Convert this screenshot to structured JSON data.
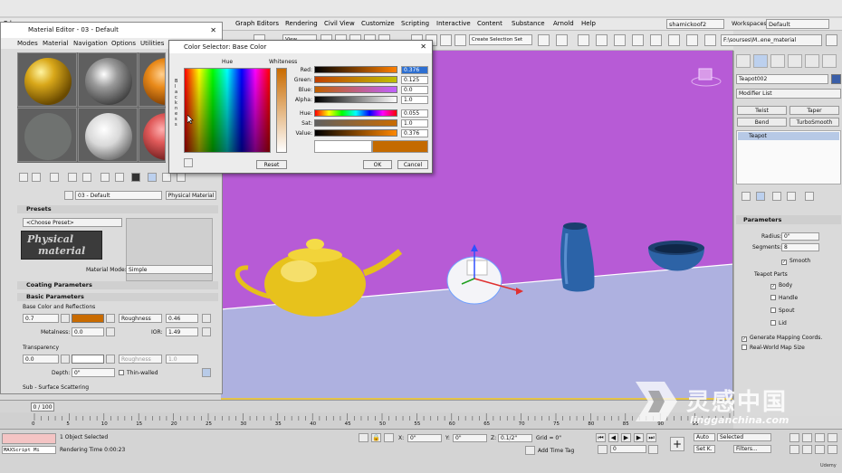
{
  "menubar": {
    "app_label": "Ed",
    "items": [
      "Graph Editors",
      "Rendering",
      "Civil View",
      "Customize",
      "Scripting",
      "Interactive",
      "Content",
      "Substance",
      "Arnold",
      "Help"
    ],
    "user": "shamickoof2",
    "workspaces_label": "Workspaces:",
    "workspace": "Default"
  },
  "toolbar": {
    "view_dropdown": "View",
    "selection_set": "Create Selection Set",
    "path": "F:\\sourses\\M..ene_material"
  },
  "material_editor": {
    "title": "Material Editor - 03 - Default",
    "menu": [
      "Modes",
      "Material",
      "Navigation",
      "Options",
      "Utilities"
    ],
    "material_name": "03 - Default",
    "material_type": "Physical Material",
    "presets_header": "Presets",
    "choose_preset": "<Choose Preset>",
    "logo_line1": "Physical",
    "logo_line2": "material",
    "material_mode_label": "Material Mode:",
    "material_mode": "Simple",
    "coating_header": "Coating Parameters",
    "basic_header": "Basic Parameters",
    "base_color_label": "Base Color and Reflections",
    "base_weight": "0.7",
    "base_color": "#c96b00",
    "roughness_label": "Roughness",
    "roughness": "0.46",
    "metalness_label": "Metalness:",
    "metalness": "0.0",
    "ior_label": "IOR:",
    "ior": "1.49",
    "transparency_label": "Transparency",
    "transparency": "0.0",
    "trans_roughness_label": "Roughness",
    "trans_roughness": "1.0",
    "depth_label": "Depth:",
    "depth": "0\"",
    "thin_walled": "Thin-walled",
    "subsurface_label": "Sub - Surface Scattering"
  },
  "color_selector": {
    "title": "Color Selector: Base Color",
    "hue_label": "Hue",
    "whiteness_label": "Whiteness",
    "blackness_letters": [
      "B",
      "l",
      "a",
      "c",
      "k",
      "n",
      "e",
      "s",
      "s"
    ],
    "rows": [
      {
        "label": "Red:",
        "value": "0.376"
      },
      {
        "label": "Green:",
        "value": "0.125"
      },
      {
        "label": "Blue:",
        "value": "0.0"
      },
      {
        "label": "Alpha:",
        "value": "1.0"
      },
      {
        "label": "Hue:",
        "value": "0.055"
      },
      {
        "label": "Sat:",
        "value": "1.0"
      },
      {
        "label": "Value:",
        "value": "0.376"
      }
    ],
    "reset": "Reset",
    "ok": "OK",
    "cancel": "Cancel"
  },
  "command_panel": {
    "object_name": "Teapot002",
    "object_color": "#3a5ea8",
    "modifier_list": "Modifier List",
    "buttons": [
      "Twist",
      "Taper",
      "Bend",
      "TurboSmooth"
    ],
    "stack_item": "Teapot",
    "parameters_header": "Parameters",
    "radius_label": "Radius:",
    "radius": "0\"",
    "segments_label": "Segments:",
    "segments": "8",
    "smooth": "Smooth",
    "teapot_parts": "Teapot Parts",
    "parts": [
      "Body",
      "Handle",
      "Spout",
      "Lid"
    ],
    "gen_mapping": "Generate Mapping Coords.",
    "real_world": "Real-World Map Size"
  },
  "timeline": {
    "frame_display": "0 / 100",
    "ticks": [
      "0",
      "5",
      "10",
      "15",
      "20",
      "25",
      "30",
      "35",
      "40",
      "45",
      "50",
      "55",
      "60",
      "65",
      "70",
      "75",
      "80",
      "85",
      "90",
      "95"
    ]
  },
  "statusbar": {
    "maxscript": "MAXScript Mi",
    "selected_text": "1 Object Selected",
    "render_time": "Rendering Time  0:00:23",
    "x_label": "X:",
    "x_value": "0\"",
    "y_label": "Y:",
    "y_value": "0\"",
    "z_label": "Z:",
    "z_value": "0.1/2\"",
    "grid": "Grid = 0\"",
    "add_time_tag": "Add Time Tag",
    "auto": "Auto",
    "selected": "Selected",
    "set_k": "Set K.",
    "filters": "Filters...",
    "frame": "0"
  },
  "watermark": {
    "cn_text": "灵感中国",
    "url": "lingganchina.com",
    "udemy": "Udemy"
  }
}
